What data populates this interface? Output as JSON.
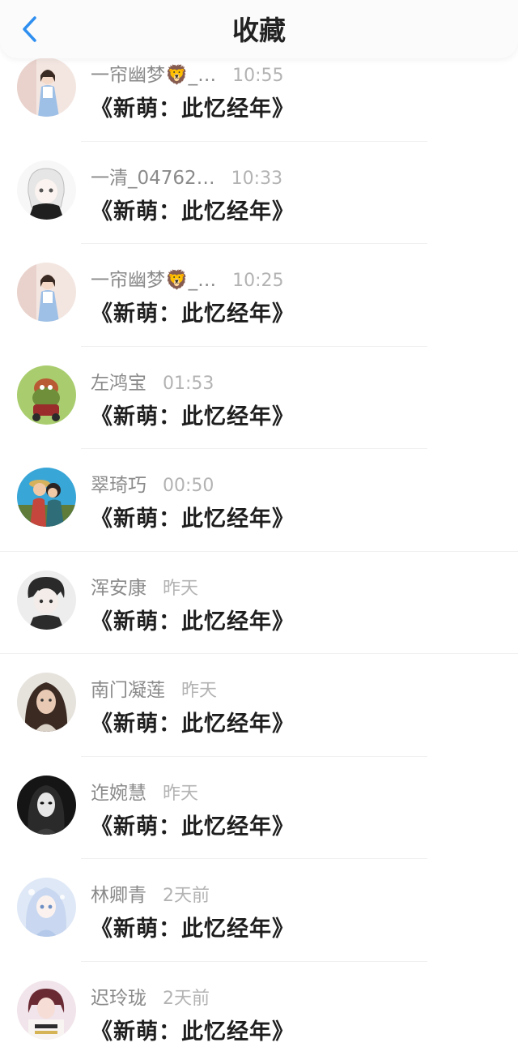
{
  "header": {
    "title": "收藏"
  },
  "items": [
    {
      "name": "一帘幽梦🦁_…",
      "time": "10:55",
      "title": "《新萌：此忆经年》"
    },
    {
      "name": "一清_04762…",
      "time": "10:33",
      "title": "《新萌：此忆经年》"
    },
    {
      "name": "一帘幽梦🦁_…",
      "time": "10:25",
      "title": "《新萌：此忆经年》"
    },
    {
      "name": "左鸿宝",
      "time": "01:53",
      "title": "《新萌：此忆经年》"
    },
    {
      "name": "翠琦巧",
      "time": "00:50",
      "title": "《新萌：此忆经年》"
    },
    {
      "name": "浑安康",
      "time": "昨天",
      "title": "《新萌：此忆经年》"
    },
    {
      "name": "南门凝莲",
      "time": "昨天",
      "title": "《新萌：此忆经年》"
    },
    {
      "name": "迮婉慧",
      "time": "昨天",
      "title": "《新萌：此忆经年》"
    },
    {
      "name": "林卿青",
      "time": "2天前",
      "title": "《新萌：此忆经年》"
    },
    {
      "name": "迟玲珑",
      "time": "2天前",
      "title": "《新萌：此忆经年》"
    }
  ],
  "colors": {
    "accent": "#2f8ff0",
    "name_gray": "#8a8a8a",
    "time_gray": "#b3b3b3"
  }
}
